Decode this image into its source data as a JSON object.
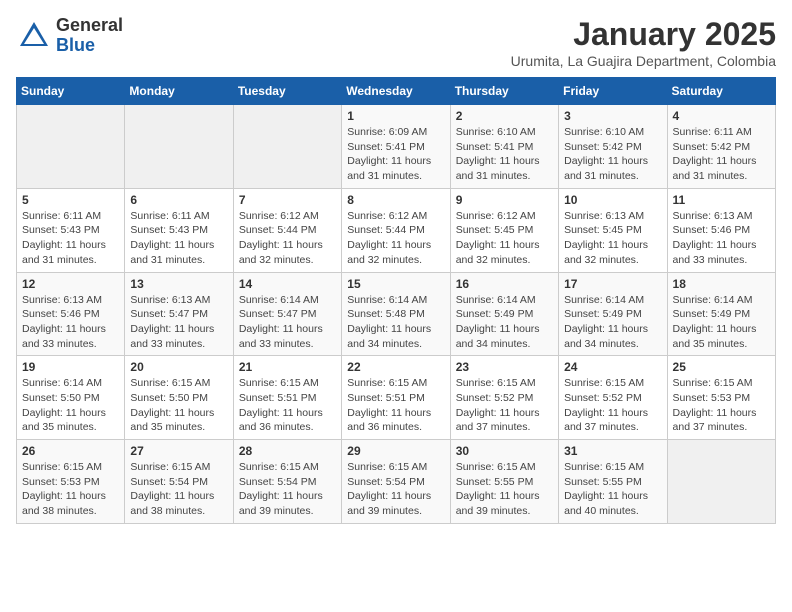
{
  "logo": {
    "general": "General",
    "blue": "Blue"
  },
  "header": {
    "month": "January 2025",
    "location": "Urumita, La Guajira Department, Colombia"
  },
  "weekdays": [
    "Sunday",
    "Monday",
    "Tuesday",
    "Wednesday",
    "Thursday",
    "Friday",
    "Saturday"
  ],
  "weeks": [
    [
      {
        "day": null,
        "info": null
      },
      {
        "day": null,
        "info": null
      },
      {
        "day": null,
        "info": null
      },
      {
        "day": "1",
        "sunrise": "6:09 AM",
        "sunset": "5:41 PM",
        "daylight": "11 hours and 31 minutes."
      },
      {
        "day": "2",
        "sunrise": "6:10 AM",
        "sunset": "5:41 PM",
        "daylight": "11 hours and 31 minutes."
      },
      {
        "day": "3",
        "sunrise": "6:10 AM",
        "sunset": "5:42 PM",
        "daylight": "11 hours and 31 minutes."
      },
      {
        "day": "4",
        "sunrise": "6:11 AM",
        "sunset": "5:42 PM",
        "daylight": "11 hours and 31 minutes."
      }
    ],
    [
      {
        "day": "5",
        "sunrise": "6:11 AM",
        "sunset": "5:43 PM",
        "daylight": "11 hours and 31 minutes."
      },
      {
        "day": "6",
        "sunrise": "6:11 AM",
        "sunset": "5:43 PM",
        "daylight": "11 hours and 31 minutes."
      },
      {
        "day": "7",
        "sunrise": "6:12 AM",
        "sunset": "5:44 PM",
        "daylight": "11 hours and 32 minutes."
      },
      {
        "day": "8",
        "sunrise": "6:12 AM",
        "sunset": "5:44 PM",
        "daylight": "11 hours and 32 minutes."
      },
      {
        "day": "9",
        "sunrise": "6:12 AM",
        "sunset": "5:45 PM",
        "daylight": "11 hours and 32 minutes."
      },
      {
        "day": "10",
        "sunrise": "6:13 AM",
        "sunset": "5:45 PM",
        "daylight": "11 hours and 32 minutes."
      },
      {
        "day": "11",
        "sunrise": "6:13 AM",
        "sunset": "5:46 PM",
        "daylight": "11 hours and 33 minutes."
      }
    ],
    [
      {
        "day": "12",
        "sunrise": "6:13 AM",
        "sunset": "5:46 PM",
        "daylight": "11 hours and 33 minutes."
      },
      {
        "day": "13",
        "sunrise": "6:13 AM",
        "sunset": "5:47 PM",
        "daylight": "11 hours and 33 minutes."
      },
      {
        "day": "14",
        "sunrise": "6:14 AM",
        "sunset": "5:47 PM",
        "daylight": "11 hours and 33 minutes."
      },
      {
        "day": "15",
        "sunrise": "6:14 AM",
        "sunset": "5:48 PM",
        "daylight": "11 hours and 34 minutes."
      },
      {
        "day": "16",
        "sunrise": "6:14 AM",
        "sunset": "5:49 PM",
        "daylight": "11 hours and 34 minutes."
      },
      {
        "day": "17",
        "sunrise": "6:14 AM",
        "sunset": "5:49 PM",
        "daylight": "11 hours and 34 minutes."
      },
      {
        "day": "18",
        "sunrise": "6:14 AM",
        "sunset": "5:49 PM",
        "daylight": "11 hours and 35 minutes."
      }
    ],
    [
      {
        "day": "19",
        "sunrise": "6:14 AM",
        "sunset": "5:50 PM",
        "daylight": "11 hours and 35 minutes."
      },
      {
        "day": "20",
        "sunrise": "6:15 AM",
        "sunset": "5:50 PM",
        "daylight": "11 hours and 35 minutes."
      },
      {
        "day": "21",
        "sunrise": "6:15 AM",
        "sunset": "5:51 PM",
        "daylight": "11 hours and 36 minutes."
      },
      {
        "day": "22",
        "sunrise": "6:15 AM",
        "sunset": "5:51 PM",
        "daylight": "11 hours and 36 minutes."
      },
      {
        "day": "23",
        "sunrise": "6:15 AM",
        "sunset": "5:52 PM",
        "daylight": "11 hours and 37 minutes."
      },
      {
        "day": "24",
        "sunrise": "6:15 AM",
        "sunset": "5:52 PM",
        "daylight": "11 hours and 37 minutes."
      },
      {
        "day": "25",
        "sunrise": "6:15 AM",
        "sunset": "5:53 PM",
        "daylight": "11 hours and 37 minutes."
      }
    ],
    [
      {
        "day": "26",
        "sunrise": "6:15 AM",
        "sunset": "5:53 PM",
        "daylight": "11 hours and 38 minutes."
      },
      {
        "day": "27",
        "sunrise": "6:15 AM",
        "sunset": "5:54 PM",
        "daylight": "11 hours and 38 minutes."
      },
      {
        "day": "28",
        "sunrise": "6:15 AM",
        "sunset": "5:54 PM",
        "daylight": "11 hours and 39 minutes."
      },
      {
        "day": "29",
        "sunrise": "6:15 AM",
        "sunset": "5:54 PM",
        "daylight": "11 hours and 39 minutes."
      },
      {
        "day": "30",
        "sunrise": "6:15 AM",
        "sunset": "5:55 PM",
        "daylight": "11 hours and 39 minutes."
      },
      {
        "day": "31",
        "sunrise": "6:15 AM",
        "sunset": "5:55 PM",
        "daylight": "11 hours and 40 minutes."
      },
      {
        "day": null,
        "info": null
      }
    ]
  ]
}
